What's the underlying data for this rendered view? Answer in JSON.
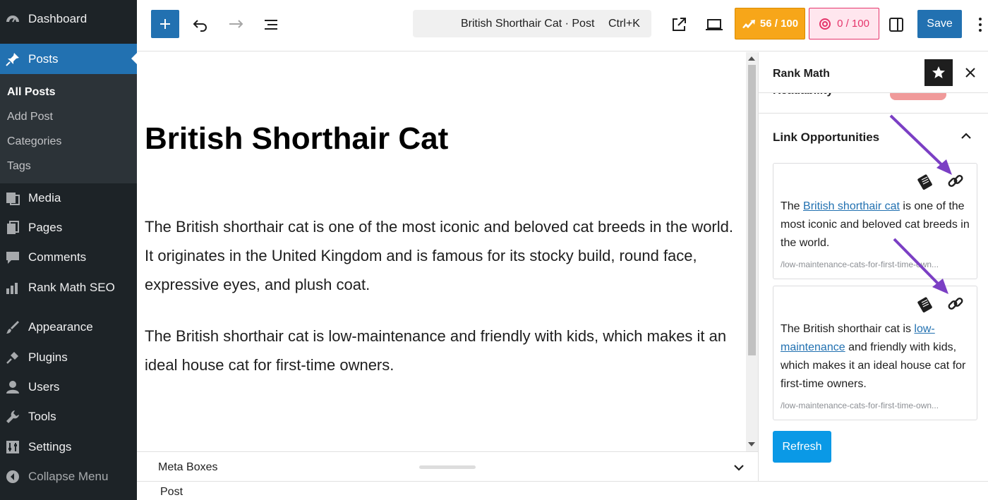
{
  "admin_menu": {
    "dashboard": "Dashboard",
    "posts": "Posts",
    "posts_submenu": [
      "All Posts",
      "Add Post",
      "Categories",
      "Tags"
    ],
    "media": "Media",
    "pages": "Pages",
    "comments": "Comments",
    "rank_math": "Rank Math SEO",
    "appearance": "Appearance",
    "plugins": "Plugins",
    "users": "Users",
    "tools": "Tools",
    "settings": "Settings",
    "collapse": "Collapse Menu"
  },
  "toolbar": {
    "command_title": "British Shorthair Cat · Post",
    "command_shortcut": "Ctrl+K",
    "seo_score": "56 / 100",
    "readability_score": "0 / 100",
    "save_label": "Save"
  },
  "post": {
    "title": "British Shorthair Cat",
    "paragraphs": [
      "The British shorthair cat is one of the most iconic and beloved cat breeds in the world. It originates in the United Kingdom and is famous for its stocky build, round face, expressive eyes, and plush coat.",
      "The British shorthair cat is low-maintenance and friendly with kids, which makes it an ideal house cat for first-time owners."
    ]
  },
  "meta_boxes": {
    "label": "Meta Boxes"
  },
  "footer": {
    "breadcrumb": "Post"
  },
  "panel": {
    "title": "Rank Math",
    "readability_peek": "Readability",
    "link_opportunities": {
      "title": "Link Opportunities",
      "cards": [
        {
          "before": "The ",
          "link": "British shorthair cat",
          "after": " is one of the most iconic and beloved cat breeds in the world.",
          "url": "/low-maintenance-cats-for-first-time-own..."
        },
        {
          "before": "The British shorthair cat is ",
          "link": "low-maintenance",
          "after": " and friendly with kids, which makes it an ideal house cat for first-time owners.",
          "url": "/low-maintenance-cats-for-first-time-own..."
        }
      ],
      "refresh_label": "Refresh"
    }
  },
  "colors": {
    "admin_bg": "#1d2327",
    "primary": "#2271b1",
    "seo_score_bg": "#f7a619",
    "readability_score": "#e5356b",
    "annotation_arrow": "#7b3fc4",
    "refresh_bg": "#0a99e6"
  }
}
